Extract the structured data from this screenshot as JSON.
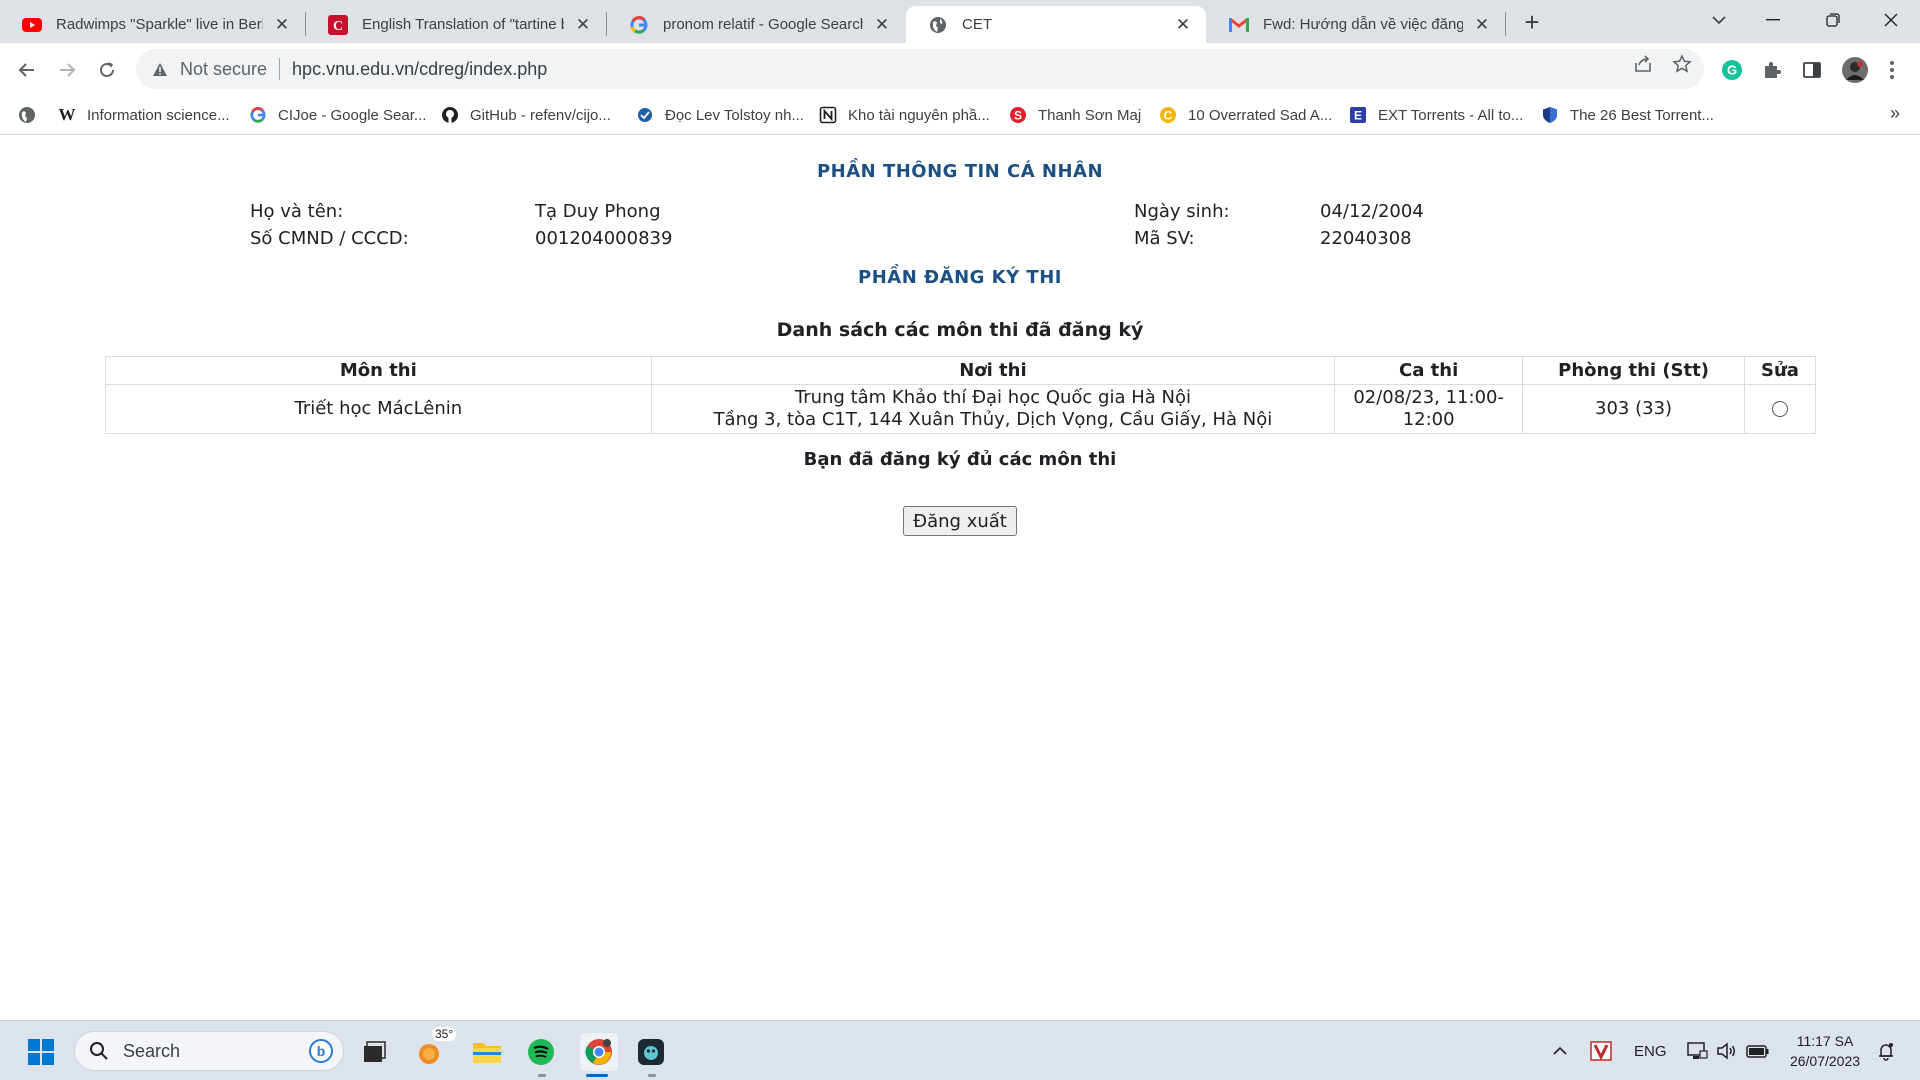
{
  "browser": {
    "tabs": [
      {
        "title": "Radwimps \"Sparkle\" live in Berlin",
        "icon": "youtube-icon",
        "active": false
      },
      {
        "title": "English Translation of \"tartine beurrée\"",
        "icon": "collins-icon",
        "active": false
      },
      {
        "title": "pronom relatif - Google Search",
        "icon": "google-icon",
        "active": false
      },
      {
        "title": "CET",
        "icon": "globe-icon",
        "active": true
      },
      {
        "title": "Fwd: Hướng dẫn về việc đăng ký",
        "icon": "gmail-icon",
        "active": false
      }
    ],
    "address": {
      "security_label": "Not secure",
      "url": "hpc.vnu.edu.vn/cdreg/index.php"
    },
    "bookmarks": [
      {
        "label": "Information science...",
        "icon": "wikipedia-icon"
      },
      {
        "label": "CIJoe - Google Sear...",
        "icon": "google-icon"
      },
      {
        "label": "GitHub - refenv/cijo...",
        "icon": "github-icon"
      },
      {
        "label": "Đọc Lev Tolstoy nh...",
        "icon": "site-icon"
      },
      {
        "label": "Kho tài nguyên phầ...",
        "icon": "notion-icon"
      },
      {
        "label": "Thanh Sơn Maj",
        "icon": "site-icon"
      },
      {
        "label": "10 Overrated Sad A...",
        "icon": "site-icon"
      },
      {
        "label": "EXT Torrents - All to...",
        "icon": "site-icon"
      },
      {
        "label": "The 26 Best Torrent...",
        "icon": "shield-icon"
      }
    ]
  },
  "personal": {
    "title": "PHẦN THÔNG TIN CÁ NHÂN",
    "name_label": "Họ và tên:",
    "name_value": "Tạ Duy Phong",
    "id_label": "Số CMND / CCCD:",
    "id_value": "001204000839",
    "dob_label": "Ngày sinh:",
    "dob_value": "04/12/2004",
    "student_label": "Mã SV:",
    "student_value": "22040308"
  },
  "registration": {
    "title": "PHẦN ĐĂNG KÝ THI",
    "list_title": "Danh sách các môn thi đã đăng ký",
    "columns": [
      "Môn thi",
      "Nơi thi",
      "Ca thi",
      "Phòng thi (Stt)",
      "Sửa"
    ],
    "rows": [
      {
        "subject": "Triết học MácLênin",
        "venue_line1": "Trung tâm Khảo thí Đại học Quốc gia Hà Nội",
        "venue_line2": "Tầng 3, tòa C1T, 144 Xuân Thủy, Dịch Vọng, Cầu Giấy, Hà Nội",
        "session_line1": "02/08/23, 11:00-",
        "session_line2": "12:00",
        "room": "303 (33)"
      }
    ],
    "status": "Bạn đã đăng ký đủ các môn thi",
    "logout_label": "Đăng xuất"
  },
  "taskbar": {
    "search_label": "Search",
    "weather_temp": "35°",
    "language": "ENG",
    "time": "11:17 SA",
    "date": "26/07/2023"
  },
  "colors": {
    "heading": "#1c4f82",
    "tabstrip": "#dee1e6",
    "taskbar": "#dde3ea"
  }
}
